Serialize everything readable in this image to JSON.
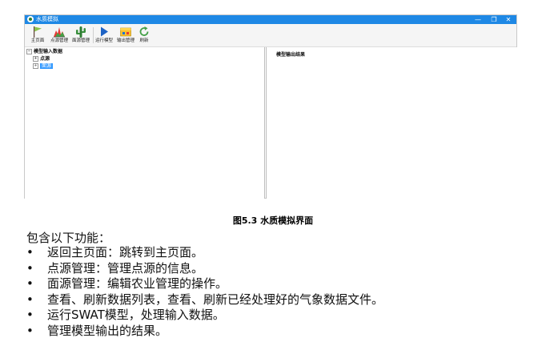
{
  "window": {
    "title": "水质模拟",
    "controls": {
      "minimize": "—",
      "maximize": "❐",
      "close": "✕"
    }
  },
  "toolbar": {
    "buttons": [
      {
        "id": "home",
        "label": "主页面",
        "icon": "flag-icon"
      },
      {
        "id": "point",
        "label": "点源管理",
        "icon": "chart-icon"
      },
      {
        "id": "area",
        "label": "面源管理",
        "icon": "cactus-icon"
      },
      {
        "id": "run",
        "label": "运行模型",
        "icon": "play-icon"
      },
      {
        "id": "output",
        "label": "输出管理",
        "icon": "output-icon"
      },
      {
        "id": "refresh",
        "label": "刷新",
        "icon": "refresh-icon"
      }
    ]
  },
  "left_pane": {
    "root": "模型输入数据",
    "children": [
      "点源",
      "面源"
    ],
    "selected": "面源"
  },
  "right_pane": {
    "title": "模型输出结果"
  },
  "caption": "图5.3 水质模拟界面",
  "intro": "包含以下功能：",
  "bullets": [
    "返回主页面：跳转到主页面。",
    "点源管理：管理点源的信息。",
    "面源管理：编辑农业管理的操作。",
    "查看、刷新数据列表，查看、刷新已经处理好的气象数据文件。",
    "运行SWAT模型，处理输入数据。",
    "管理模型输出的结果。"
  ],
  "bullet_char": "•",
  "colors": {
    "titlebar": "#1e88e5",
    "selection": "#3399ff"
  }
}
